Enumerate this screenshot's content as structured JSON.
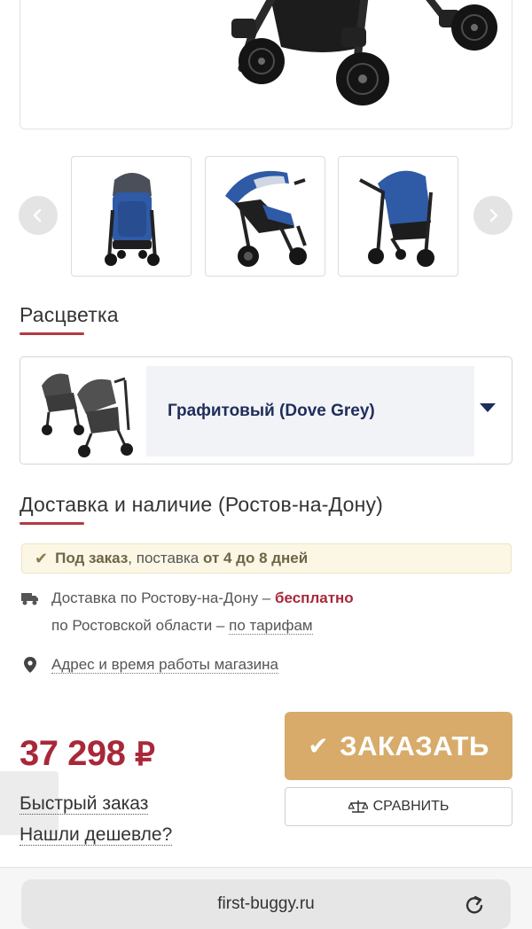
{
  "product": {
    "hero_image": "stroller-photo-main",
    "thumbnails": [
      {
        "image": "stroller-front-blue"
      },
      {
        "image": "stroller-side-blue"
      },
      {
        "image": "stroller-angle-blue"
      }
    ]
  },
  "color_section": {
    "title": "Расцветка",
    "selected": "Графитовый (Dove Grey)",
    "swatch_image": "stroller-grey-swatch"
  },
  "delivery_section": {
    "title": "Доставка и наличие (Ростов-на-Дону)",
    "availability": {
      "status": "Под заказ",
      "middle": ", поставка ",
      "period": "от 4 до 8 дней"
    },
    "city_delivery": {
      "prefix": "Доставка по Ростову-на-Дону – ",
      "value": "бесплатно"
    },
    "region_delivery": {
      "prefix": "по Ростовской области – ",
      "link": "по тарифам"
    },
    "store_link": "Адрес и время работы магазина"
  },
  "price": {
    "value": "37 298",
    "currency": "₽"
  },
  "actions": {
    "order_label": "ЗАКАЗАТЬ",
    "compare_label": "СРАВНИТЬ",
    "quick_order": "Быстрый заказ",
    "found_cheaper": "Нашли дешевле?"
  },
  "browser": {
    "url": "first-buggy.ru"
  },
  "colors": {
    "accent_red": "#a8283a",
    "order_button": "#d8ab6a",
    "select_text": "#1f2d5a",
    "stroller_blue": "#2f5aa6"
  },
  "icons": {
    "prev": "chevron-left-icon",
    "next": "chevron-right-icon",
    "truck": "truck-icon",
    "pin": "location-pin-icon",
    "scales": "scales-icon",
    "check": "checkmark-icon",
    "reload": "reload-icon"
  }
}
